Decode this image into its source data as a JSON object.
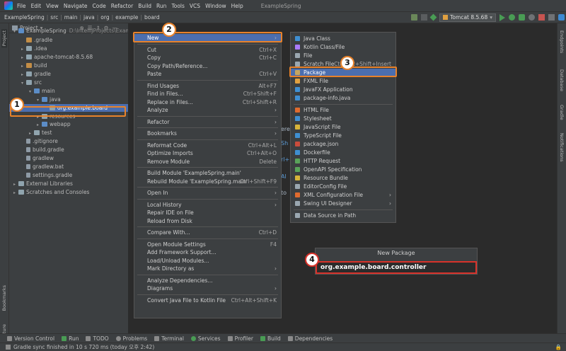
{
  "menubar": {
    "items": [
      "File",
      "Edit",
      "View",
      "Navigate",
      "Code",
      "Refactor",
      "Build",
      "Run",
      "Tools",
      "VCS",
      "Window",
      "Help"
    ],
    "title": "ExampleSpring"
  },
  "breadcrumbs": [
    "ExampleSpring",
    "src",
    "main",
    "java",
    "org",
    "example",
    "board"
  ],
  "run_config": "Tomcat 8.5.68",
  "project_panel": {
    "title": "Project"
  },
  "tree": [
    {
      "label": "ExampleSpring",
      "extra": "D:\\IntelliJProjects\\Example",
      "indent": 0
    },
    {
      "label": ".gradle",
      "indent": 1
    },
    {
      "label": ".idea",
      "indent": 1
    },
    {
      "label": "apache-tomcat-8.5.68",
      "indent": 1
    },
    {
      "label": "build",
      "indent": 1
    },
    {
      "label": "gradle",
      "indent": 1
    },
    {
      "label": "src",
      "indent": 1
    },
    {
      "label": "main",
      "indent": 2
    },
    {
      "label": "java",
      "indent": 3
    },
    {
      "label": "org.example.board",
      "indent": 4
    },
    {
      "label": "resources",
      "indent": 3
    },
    {
      "label": "webapp",
      "indent": 3
    },
    {
      "label": "test",
      "indent": 2
    },
    {
      "label": ".gitignore",
      "indent": 1
    },
    {
      "label": "build.gradle",
      "indent": 1
    },
    {
      "label": "gradlew",
      "indent": 1
    },
    {
      "label": "gradlew.bat",
      "indent": 1
    },
    {
      "label": "settings.gradle",
      "indent": 1
    },
    {
      "label": "External Libraries",
      "indent": 0
    },
    {
      "label": "Scratches and Consoles",
      "indent": 0
    }
  ],
  "context_menu": [
    {
      "label": "New",
      "sc": "",
      "sub": true,
      "hl": true
    },
    {
      "sep": true
    },
    {
      "label": "Cut",
      "sc": "Ctrl+X"
    },
    {
      "label": "Copy",
      "sc": "Ctrl+C"
    },
    {
      "label": "Copy Path/Reference...",
      "sc": ""
    },
    {
      "label": "Paste",
      "sc": "Ctrl+V"
    },
    {
      "sep": true
    },
    {
      "label": "Find Usages",
      "sc": "Alt+F7"
    },
    {
      "label": "Find in Files...",
      "sc": "Ctrl+Shift+F"
    },
    {
      "label": "Replace in Files...",
      "sc": "Ctrl+Shift+R"
    },
    {
      "label": "Analyze",
      "sc": "",
      "sub": true
    },
    {
      "sep": true
    },
    {
      "label": "Refactor",
      "sc": "",
      "sub": true
    },
    {
      "sep": true
    },
    {
      "label": "Bookmarks",
      "sc": "",
      "sub": true
    },
    {
      "sep": true
    },
    {
      "label": "Reformat Code",
      "sc": "Ctrl+Alt+L"
    },
    {
      "label": "Optimize Imports",
      "sc": "Ctrl+Alt+O"
    },
    {
      "label": "Remove Module",
      "sc": "Delete"
    },
    {
      "sep": true
    },
    {
      "label": "Build Module 'ExampleSpring.main'",
      "sc": ""
    },
    {
      "label": "Rebuild Module 'ExampleSpring.main'",
      "sc": "Ctrl+Shift+F9"
    },
    {
      "sep": true
    },
    {
      "label": "Open In",
      "sc": "",
      "sub": true
    },
    {
      "sep": true
    },
    {
      "label": "Local History",
      "sc": "",
      "sub": true
    },
    {
      "label": "Repair IDE on File",
      "sc": ""
    },
    {
      "label": "Reload from Disk",
      "sc": ""
    },
    {
      "sep": true
    },
    {
      "label": "Compare With...",
      "sc": "Ctrl+D"
    },
    {
      "sep": true
    },
    {
      "label": "Open Module Settings",
      "sc": "F4"
    },
    {
      "label": "Add Framework Support...",
      "sc": ""
    },
    {
      "label": "Load/Unload Modules...",
      "sc": ""
    },
    {
      "label": "Mark Directory as",
      "sc": "",
      "sub": true
    },
    {
      "sep": true
    },
    {
      "label": "Analyze Dependencies...",
      "sc": ""
    },
    {
      "label": "Diagrams",
      "sc": "",
      "sub": true
    },
    {
      "sep": true
    },
    {
      "label": "Convert Java File to Kotlin File",
      "sc": "Ctrl+Alt+Shift+K"
    }
  ],
  "new_submenu": [
    {
      "label": "Java Class",
      "color": "#3f8fd2"
    },
    {
      "label": "Kotlin Class/File",
      "color": "#a97bff"
    },
    {
      "label": "File",
      "color": "#9aa7b0"
    },
    {
      "label": "Scratch File",
      "sc": "Ctrl+Alt+Shift+Insert",
      "color": "#9aa7b0"
    },
    {
      "label": "Package",
      "hl": true,
      "color": "#c7a660"
    },
    {
      "label": "FXML File",
      "color": "#e0a040"
    },
    {
      "label": "JavaFX Application",
      "color": "#3f8fd2"
    },
    {
      "label": "package-info.java",
      "color": "#3f8fd2"
    },
    {
      "sep": true
    },
    {
      "label": "HTML File",
      "color": "#e06b2e"
    },
    {
      "label": "Stylesheet",
      "color": "#3f8fd2"
    },
    {
      "label": "JavaScript File",
      "color": "#d6b43a"
    },
    {
      "label": "TypeScript File",
      "color": "#3f8fd2"
    },
    {
      "label": "package.json",
      "color": "#c94c3c"
    },
    {
      "label": "Dockerfile",
      "color": "#3f8fd2"
    },
    {
      "label": "HTTP Request",
      "color": "#5aa35a"
    },
    {
      "label": "OpenAPI Specification",
      "color": "#5aa35a"
    },
    {
      "label": "Resource Bundle",
      "color": "#d6b43a"
    },
    {
      "label": "EditorConfig File",
      "color": "#9aa7b0"
    },
    {
      "label": "XML Configuration File",
      "sub": true,
      "color": "#e06b2e"
    },
    {
      "label": "Swing UI Designer",
      "sub": true,
      "color": "#9aa7b0"
    },
    {
      "sep": true
    },
    {
      "label": "Data Source in Path",
      "color": "#9aa7b0"
    }
  ],
  "new_package": {
    "title": "New Package",
    "value": "org.example.board.controller"
  },
  "editor_fragments": [
    "ere",
    "Sh",
    "rl+",
    "Al",
    "to"
  ],
  "badges": [
    "1",
    "2",
    "3",
    "4"
  ],
  "bottom_tabs": [
    "Version Control",
    "Run",
    "TODO",
    "Problems",
    "Terminal",
    "Services",
    "Profiler",
    "Build",
    "Dependencies"
  ],
  "status": "Gradle sync finished in 10 s 720 ms (today 오후 2:42)",
  "right_tabs": [
    "Endpoints",
    "Database",
    "Gradle",
    "Notifications"
  ],
  "left_tabs": [
    "Project",
    "Bookmarks",
    "Structure"
  ]
}
